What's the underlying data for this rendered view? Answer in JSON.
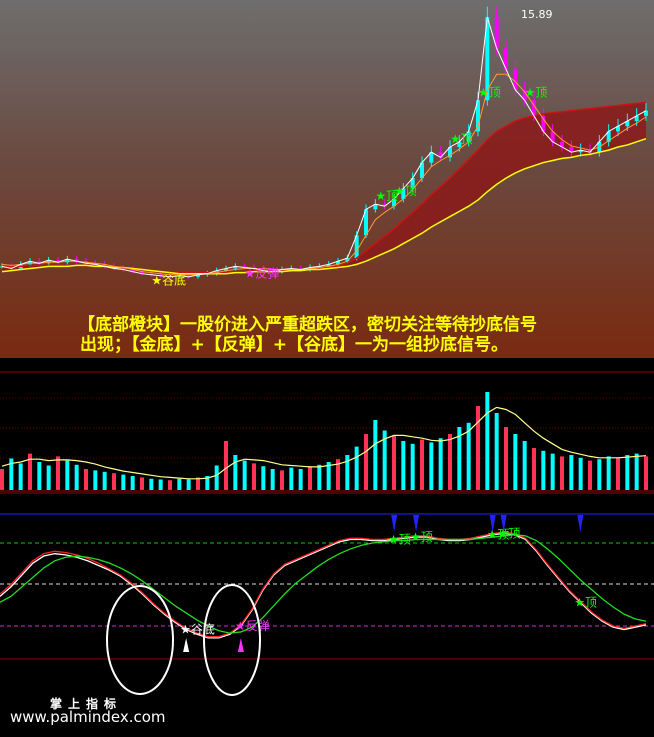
{
  "title": "",
  "caption": {
    "line1": "【底部橙块】一股价进入严重超跌区，密切关注等待抄底信号",
    "line2": "出现；【金底】+【反弹】+【谷底】一为一组抄底信号。"
  },
  "watermark": {
    "cn": "掌上指标",
    "url": "www.palmindex.com"
  },
  "colors": {
    "background": "#000000",
    "price_up": "#00ffff",
    "price_down": "#ff00ff",
    "signal_green": "#00ff00",
    "signal_magenta": "#ff33ff",
    "signal_yellow": "#ffff00",
    "caption": "#ffff00",
    "band_fill": "#8b1a1a",
    "slow_ma": "#ffff00"
  },
  "chart_data": [
    {
      "type": "line",
      "panel": "price",
      "title": "",
      "xlabel": "",
      "ylabel": "",
      "price_label": "15.89",
      "series": [
        {
          "role": "close",
          "values": [
            1.0,
            0.98,
            1.02,
            1.05,
            1.03,
            1.06,
            1.04,
            1.07,
            1.05,
            1.03,
            1.02,
            1.0,
            0.98,
            0.97,
            0.95,
            0.93,
            0.92,
            0.91,
            0.9,
            0.91,
            0.9,
            0.92,
            0.93,
            0.96,
            0.98,
            1.0,
            0.99,
            0.98,
            0.96,
            0.95,
            0.97,
            0.98,
            0.97,
            0.99,
            1.0,
            1.02,
            1.05,
            1.08,
            1.3,
            1.55,
            1.6,
            1.58,
            1.65,
            1.75,
            1.85,
            2.0,
            2.1,
            2.05,
            2.15,
            2.2,
            2.3,
            2.6,
            3.4,
            3.1,
            2.9,
            2.7,
            2.6,
            2.45,
            2.3,
            2.2,
            2.15,
            2.1,
            2.12,
            2.1,
            2.2,
            2.3,
            2.35,
            2.4,
            2.45,
            2.5
          ]
        },
        {
          "role": "fast_ma",
          "values": [
            1.02,
            1.01,
            1.02,
            1.03,
            1.03,
            1.04,
            1.04,
            1.05,
            1.05,
            1.04,
            1.03,
            1.02,
            1.0,
            0.99,
            0.97,
            0.95,
            0.94,
            0.93,
            0.92,
            0.92,
            0.92,
            0.92,
            0.93,
            0.94,
            0.96,
            0.97,
            0.98,
            0.98,
            0.98,
            0.97,
            0.97,
            0.97,
            0.97,
            0.98,
            0.99,
            1.0,
            1.02,
            1.05,
            1.15,
            1.3,
            1.45,
            1.52,
            1.58,
            1.65,
            1.74,
            1.85,
            1.96,
            2.02,
            2.07,
            2.13,
            2.2,
            2.35,
            2.7,
            2.85,
            2.85,
            2.78,
            2.68,
            2.55,
            2.42,
            2.3,
            2.22,
            2.16,
            2.14,
            2.12,
            2.15,
            2.21,
            2.27,
            2.33,
            2.38,
            2.44
          ]
        },
        {
          "role": "slow_ma",
          "values": [
            0.95,
            0.96,
            0.97,
            0.98,
            0.99,
            1.0,
            1.0,
            1.0,
            1.01,
            1.01,
            1.0,
            1.0,
            0.99,
            0.99,
            0.98,
            0.97,
            0.96,
            0.95,
            0.94,
            0.93,
            0.93,
            0.93,
            0.93,
            0.93,
            0.93,
            0.94,
            0.94,
            0.95,
            0.95,
            0.95,
            0.95,
            0.96,
            0.96,
            0.97,
            0.97,
            0.98,
            0.99,
            1.0,
            1.02,
            1.05,
            1.09,
            1.13,
            1.17,
            1.22,
            1.27,
            1.32,
            1.38,
            1.43,
            1.48,
            1.53,
            1.58,
            1.64,
            1.72,
            1.79,
            1.85,
            1.9,
            1.94,
            1.97,
            2.0,
            2.02,
            2.04,
            2.05,
            2.07,
            2.08,
            2.1,
            2.12,
            2.15,
            2.17,
            2.2,
            2.23
          ]
        },
        {
          "role": "band_top",
          "values": [
            1.0,
            1.0,
            1.0,
            1.01,
            1.01,
            1.01,
            1.01,
            1.01,
            1.01,
            1.01,
            1.01,
            1.0,
            1.0,
            0.99,
            0.98,
            0.97,
            0.96,
            0.95,
            0.94,
            0.94,
            0.94,
            0.94,
            0.94,
            0.94,
            0.94,
            0.95,
            0.95,
            0.96,
            0.96,
            0.96,
            0.96,
            0.97,
            0.97,
            0.98,
            0.98,
            0.99,
            1.0,
            1.03,
            1.08,
            1.15,
            1.22,
            1.29,
            1.36,
            1.44,
            1.52,
            1.6,
            1.69,
            1.77,
            1.85,
            1.94,
            2.03,
            2.12,
            2.22,
            2.3,
            2.35,
            2.4,
            2.43,
            2.45,
            2.47,
            2.48,
            2.49,
            2.5,
            2.51,
            2.52,
            2.53,
            2.54,
            2.55,
            2.56,
            2.57,
            2.58
          ]
        }
      ],
      "signals": [
        {
          "label": "谷底",
          "color": "yellow",
          "x_index": 16
        },
        {
          "label": "反弹",
          "color": "magenta",
          "x_index": 26
        },
        {
          "label": "顶",
          "color": "green",
          "x_index": 40
        },
        {
          "label": "顶",
          "color": "green",
          "x_index": 42
        },
        {
          "label": "顶",
          "color": "green",
          "x_index": 48
        },
        {
          "label": "顶",
          "color": "green",
          "x_index": 51
        },
        {
          "label": "顶",
          "color": "green",
          "x_index": 56
        }
      ]
    },
    {
      "type": "bar",
      "panel": "volume",
      "title": "",
      "values": [
        30,
        45,
        38,
        52,
        40,
        35,
        48,
        42,
        36,
        30,
        28,
        26,
        24,
        22,
        20,
        18,
        16,
        15,
        14,
        16,
        15,
        18,
        20,
        35,
        70,
        50,
        42,
        38,
        34,
        30,
        28,
        32,
        30,
        34,
        36,
        40,
        44,
        50,
        62,
        80,
        100,
        85,
        78,
        70,
        66,
        72,
        68,
        74,
        80,
        90,
        96,
        120,
        140,
        110,
        90,
        80,
        70,
        60,
        56,
        52,
        48,
        50,
        46,
        42,
        44,
        48,
        46,
        50,
        52,
        48
      ],
      "ma_values": [
        34,
        38,
        40,
        44,
        44,
        42,
        43,
        43,
        42,
        40,
        37,
        33,
        30,
        27,
        25,
        23,
        21,
        19,
        18,
        17,
        16,
        16,
        17,
        21,
        31,
        40,
        44,
        43,
        42,
        39,
        36,
        35,
        34,
        33,
        33,
        35,
        37,
        41,
        47,
        55,
        66,
        73,
        78,
        78,
        76,
        74,
        71,
        70,
        72,
        77,
        84,
        97,
        110,
        118,
        115,
        108,
        96,
        84,
        74,
        66,
        58,
        54,
        51,
        48,
        46,
        46,
        46,
        47,
        48,
        49
      ]
    },
    {
      "type": "line",
      "panel": "oscillator",
      "title": "",
      "series": [
        {
          "role": "white_line",
          "values": [
            40,
            48,
            58,
            68,
            74,
            76,
            75,
            73,
            70,
            66,
            62,
            57,
            50,
            42,
            33,
            25,
            18,
            12,
            8,
            5,
            5,
            8,
            15,
            28,
            45,
            58,
            66,
            70,
            74,
            78,
            82,
            86,
            88,
            88,
            87,
            87,
            88,
            89,
            90,
            90,
            88,
            87,
            87,
            88,
            90,
            92,
            93,
            92,
            88,
            78,
            66,
            55,
            44,
            35,
            26,
            19,
            14,
            12,
            14,
            16
          ]
        },
        {
          "role": "red_line",
          "values": [
            42,
            50,
            60,
            70,
            76,
            78,
            77,
            75,
            72,
            68,
            63,
            58,
            51,
            43,
            34,
            26,
            19,
            13,
            9,
            6,
            6,
            9,
            16,
            29,
            46,
            59,
            67,
            71,
            75,
            79,
            83,
            87,
            89,
            89,
            88,
            88,
            89,
            90,
            91,
            91,
            89,
            88,
            88,
            89,
            91,
            93,
            94,
            93,
            89,
            79,
            67,
            56,
            45,
            36,
            27,
            20,
            15,
            13,
            15,
            17
          ]
        },
        {
          "role": "green_line",
          "values": [
            35,
            40,
            48,
            56,
            64,
            70,
            73,
            74,
            73,
            71,
            68,
            64,
            59,
            53,
            46,
            39,
            32,
            26,
            20,
            15,
            11,
            9,
            10,
            14,
            22,
            32,
            42,
            51,
            58,
            65,
            71,
            76,
            80,
            83,
            85,
            86,
            87,
            87,
            88,
            88,
            88,
            88,
            88,
            88,
            89,
            90,
            91,
            92,
            91,
            87,
            80,
            72,
            63,
            54,
            46,
            38,
            31,
            25,
            21,
            19
          ]
        }
      ],
      "reference_levels": {
        "top": 85,
        "middle": 50,
        "bottom": 15
      },
      "signals": [
        {
          "label": "谷底",
          "color": "white",
          "x_index": 17
        },
        {
          "label": "反弹",
          "color": "magenta",
          "x_index": 22
        },
        {
          "label": "顶",
          "color": "green",
          "x_index": 36
        },
        {
          "label": "顶",
          "color": "green",
          "x_index": 38
        },
        {
          "label": "顶",
          "color": "green",
          "x_index": 45
        },
        {
          "label": "顶",
          "color": "green",
          "x_index": 46
        },
        {
          "label": "顶",
          "color": "green",
          "x_index": 53
        }
      ]
    }
  ]
}
